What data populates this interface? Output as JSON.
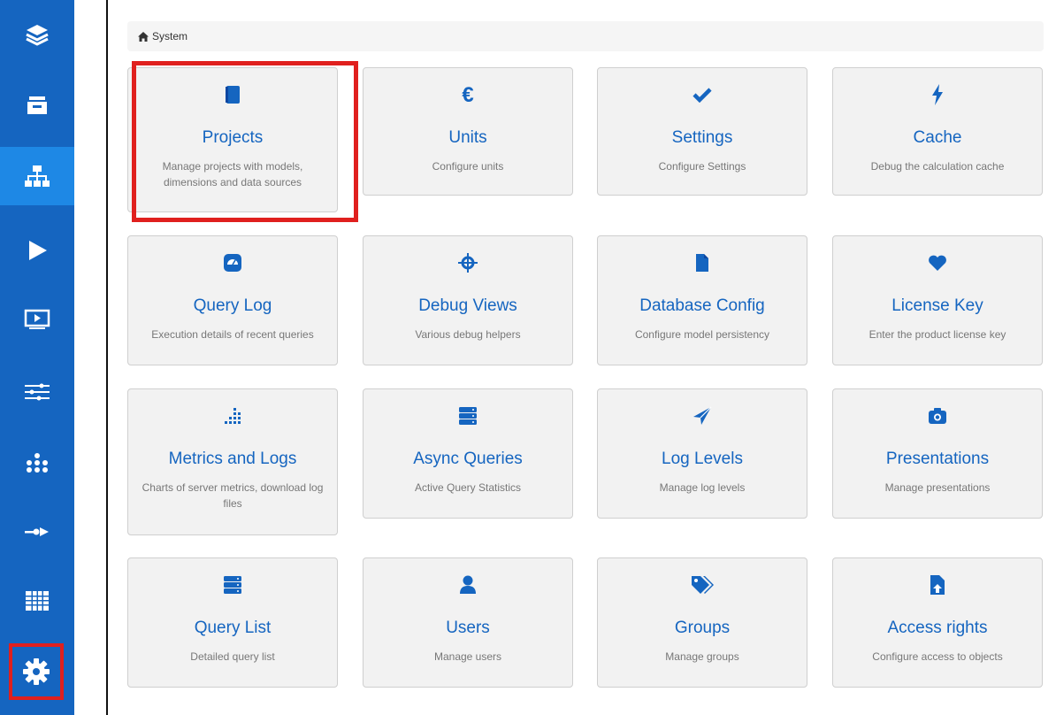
{
  "breadcrumb": {
    "label": "System"
  },
  "cards": [
    {
      "title": "Projects",
      "desc": "Manage projects with models, dimensions and data sources"
    },
    {
      "title": "Units",
      "desc": "Configure units"
    },
    {
      "title": "Settings",
      "desc": "Configure Settings"
    },
    {
      "title": "Cache",
      "desc": "Debug the calculation cache"
    },
    {
      "title": "Query Log",
      "desc": "Execution details of recent queries"
    },
    {
      "title": "Debug Views",
      "desc": "Various debug helpers"
    },
    {
      "title": "Database Config",
      "desc": "Configure model persistency"
    },
    {
      "title": "License Key",
      "desc": "Enter the product license key"
    },
    {
      "title": "Metrics and Logs",
      "desc": "Charts of server metrics, download log files"
    },
    {
      "title": "Async Queries",
      "desc": "Active Query Statistics"
    },
    {
      "title": "Log Levels",
      "desc": "Manage log levels"
    },
    {
      "title": "Presentations",
      "desc": "Manage presentations"
    },
    {
      "title": "Query List",
      "desc": "Detailed query list"
    },
    {
      "title": "Users",
      "desc": "Manage users"
    },
    {
      "title": "Groups",
      "desc": "Manage groups"
    },
    {
      "title": "Access rights",
      "desc": "Configure access to objects"
    }
  ],
  "icons": {
    "sidebar": [
      "layers-icon",
      "archive-icon",
      "sitemap-icon",
      "play-icon",
      "presentation-icon",
      "sliders-icon",
      "network-icon",
      "connector-icon",
      "table-icon",
      "gear-icon"
    ],
    "cards": [
      "book-icon",
      "euro-icon",
      "check-icon",
      "bolt-icon",
      "dashboard-icon",
      "crosshair-icon",
      "file-icon",
      "heart-icon",
      "bar-chart-icon",
      "server-icon",
      "send-icon",
      "camera-icon",
      "database-list-icon",
      "user-icon",
      "tags-icon",
      "access-icon"
    ]
  },
  "colors": {
    "sidebar": "#1565c0",
    "sidebar_active": "#1e88e5",
    "accent": "#1565c0",
    "highlight": "#e0201e",
    "card_bg": "#f2f2f2"
  }
}
